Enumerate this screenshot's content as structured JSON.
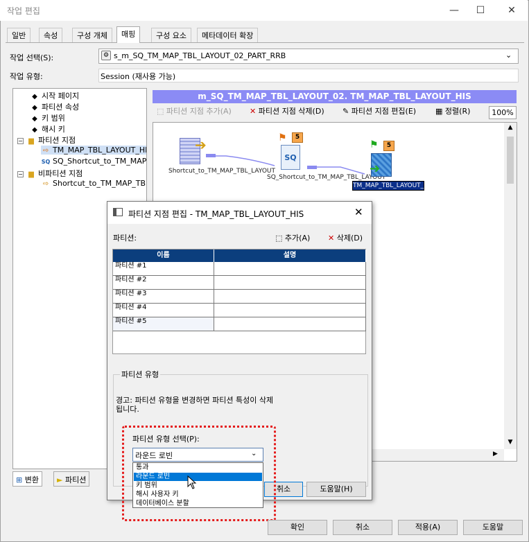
{
  "window": {
    "title": "작업 편집"
  },
  "tabs": [
    "일반",
    "속성",
    "구성 개체",
    "매핑",
    "구성 요소",
    "메타데이터 확장"
  ],
  "task_select": {
    "label": "작업 선택(S):",
    "value": "s_m_SQ_TM_MAP_TBL_LAYOUT_02_PART_RRB"
  },
  "task_type": {
    "label": "작업 유형:",
    "value": "Session (재사용 가능)"
  },
  "tree": {
    "items": [
      "시작 페이지",
      "파티션 속성",
      "키 범위",
      "해시 키",
      "파티션 지점",
      "TM_MAP_TBL_LAYOUT_HIS",
      "SQ_Shortcut_to_TM_MAP_",
      "비파티션 지점",
      "Shortcut_to_TM_MAP_TBL_"
    ]
  },
  "bottom_tabs": [
    "변환",
    "파티션"
  ],
  "mapping": {
    "header": "m_SQ_TM_MAP_TBL_LAYOUT_02. TM_MAP_TBL_LAYOUT_HIS",
    "toolbar": {
      "add": "파티션 지점 추가(A)",
      "delete": "파티션 지점 삭제(D)",
      "edit": "파티션 지점 편집(E)",
      "arrange": "정렬(R)",
      "zoom": "100%"
    },
    "nodes": [
      {
        "caption": "Shortcut_to_TM_MAP_TBL_LAYOUT"
      },
      {
        "caption": "SQ_Shortcut_to_TM_MAP_TBL_LAYOUT",
        "badge": "5"
      },
      {
        "caption": "TM_MAP_TBL_LAYOUT_HIS",
        "badge": "5"
      }
    ]
  },
  "dialog": {
    "title": "파티션 지점 편집 - TM_MAP_TBL_LAYOUT_HIS",
    "partitions_label": "파티션:",
    "add": "추가(A)",
    "delete": "삭제(D)",
    "columns": [
      "이름",
      "설명"
    ],
    "rows": [
      "파티션 #1",
      "파티션 #2",
      "파티션 #3",
      "파티션 #4",
      "파티션 #5"
    ],
    "group_title": "파티션 유형",
    "warning_line1": "경고: 파티션 유형을 변경하면 파티션 특성이 삭제",
    "warning_line2": "됩니다.",
    "select_label": "파티션 유형 선택(P):",
    "selected": "라운드 로빈",
    "options": [
      "통과",
      "라운드 로빈",
      "키 범위",
      "해시 사용자 키",
      "데이터베이스 분할"
    ],
    "cancel": "취소",
    "help": "도움말(H)"
  },
  "footer": {
    "ok": "확인",
    "cancel": "취소",
    "apply": "적용(A)",
    "help": "도움말"
  },
  "colors": {
    "selection": "#0078d7",
    "header_bar": "#8b8bf5",
    "grid_header": "#0b3e7d",
    "highlight": "#e41a1a"
  }
}
